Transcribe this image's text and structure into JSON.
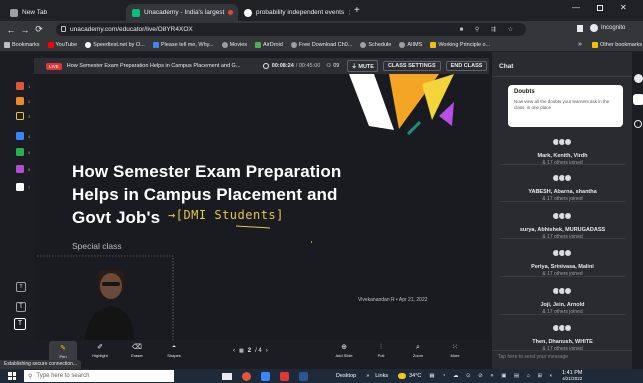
{
  "browser": {
    "tabs": [
      {
        "title": "New Tab",
        "favicon_color": "#9aa0a6"
      },
      {
        "title": "Unacademy - India's largest",
        "favicon_color": "#08bd80",
        "recording": true
      },
      {
        "title": "probability independent events",
        "favicon_color": "#ffffff"
      }
    ],
    "new_tab_symbol": "+",
    "url": "unacademy.com/educator/live/O8YR4XOX",
    "profile_label": "Incognito",
    "bookmarks": [
      {
        "label": "Bookmarks",
        "color": "#bdc1c6"
      },
      {
        "label": "YouTube",
        "color": "#ff0000"
      },
      {
        "label": "Speedtest.net by O...",
        "color": "#ffffff"
      },
      {
        "label": "Please tell me, Why...",
        "color": "#4285f4"
      },
      {
        "label": "Movies",
        "color": "#9aa0a6"
      },
      {
        "label": "AirDroid",
        "color": "#4caf50"
      },
      {
        "label": "Free Download Ch0...",
        "color": "#9aa0a6"
      },
      {
        "label": "Schedule",
        "color": "#9aa0a6"
      },
      {
        "label": "AIIMS",
        "color": "#9aa0a6"
      },
      {
        "label": "Working Principle o...",
        "color": "#fbbc04"
      }
    ],
    "bookmarks_overflow": "»",
    "other_bookmarks": "Other bookmarks"
  },
  "classroom": {
    "live_badge": "LIVE",
    "session_title": "How Semester Exam Preparation Helps in Campus Placement and G...",
    "elapsed": "00:08:24",
    "duration": "/ 00:45:00",
    "viewers": "09",
    "mute_label": "MUTE",
    "settings_label": "CLASS SETTINGS",
    "end_label": "END CLASS",
    "slide_title": "How Semester Exam Preparation Helps in Campus Placement and Govt Job's",
    "annotation": "→[DMI Students]",
    "special_label": "Special class",
    "educator_credit": "Vivekanandan R",
    "credit_date": "Apr 21, 2022",
    "page_current": "2",
    "page_total": "/ 4",
    "tools": [
      {
        "label": "Pen",
        "icon": "pen-icon"
      },
      {
        "label": "Highlight",
        "icon": "highlighter-icon"
      },
      {
        "label": "Eraser",
        "icon": "eraser-icon"
      },
      {
        "label": "Shapes",
        "icon": "shapes-icon"
      }
    ],
    "actions": [
      {
        "label": "Add Slide",
        "icon": "add-slide-icon"
      },
      {
        "label": "Poll",
        "icon": "poll-icon"
      },
      {
        "label": "Zoom",
        "icon": "zoom-icon"
      },
      {
        "label": "More",
        "icon": "more-icon"
      }
    ],
    "color_palette": [
      "#e0563a",
      "#f08a24",
      "#f5c518",
      "#3a86ff",
      "#22b14c",
      "#b04dd1",
      "#ffffff"
    ],
    "palette_indices": [
      "1",
      "2",
      "3",
      "4",
      "5",
      "6",
      "7"
    ]
  },
  "chat": {
    "header": "Chat",
    "doubts_title": "Doubts",
    "doubts_body": "Now view all the doubts your learners ask in the class, in one place",
    "participants": [
      {
        "names": "Mark, Kenith, Virdh",
        "others": "& 17 others joined"
      },
      {
        "names": "YABESH, Abarna, shantha",
        "others": "& 17 others joined"
      },
      {
        "names": "surya, Abhishek, MURUGADASS",
        "others": "& 17 others joined"
      },
      {
        "names": "Periya, Srinivasa, Malini",
        "others": "& 17 others joined"
      },
      {
        "names": "Joji, Jein, Arnold",
        "others": "& 17 others joined"
      },
      {
        "names": "Then, Dhanush, WHITE",
        "others": "& 17 others joined"
      }
    ],
    "input_placeholder": "Tap here to send your message"
  },
  "status_text": "Establishing secure connection...",
  "taskbar": {
    "search_placeholder": "Type here to search",
    "desktop_label": "Desktop",
    "links_label": "Links",
    "weather": "34°C",
    "time": "1:41 PM",
    "date": "4/21/2022"
  }
}
